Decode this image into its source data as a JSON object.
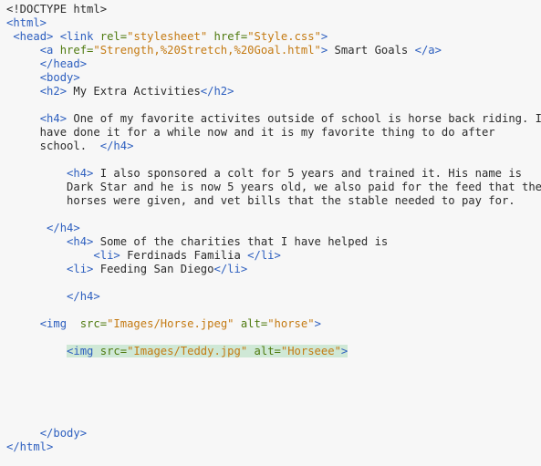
{
  "editor": {
    "lines": [
      [
        [
          "txt",
          "<!DOCTYPE html>"
        ]
      ],
      [
        [
          "tag",
          "<html>"
        ]
      ],
      [
        [
          "txt",
          " "
        ],
        [
          "tag",
          "<head>"
        ],
        [
          "txt",
          " "
        ],
        [
          "tag",
          "<link "
        ],
        [
          "attr",
          "rel="
        ],
        [
          "str",
          "\"stylesheet\""
        ],
        [
          "txt",
          " "
        ],
        [
          "attr",
          "href="
        ],
        [
          "str",
          "\"Style.css\""
        ],
        [
          "tag",
          ">"
        ]
      ],
      [
        [
          "txt",
          "     "
        ],
        [
          "tag",
          "<a "
        ],
        [
          "attr",
          "href="
        ],
        [
          "str",
          "\"Strength,%20Stretch,%20Goal.html\""
        ],
        [
          "tag",
          ">"
        ],
        [
          "txt",
          " Smart Goals "
        ],
        [
          "tag",
          "</a>"
        ]
      ],
      [
        [
          "txt",
          "     "
        ],
        [
          "tag",
          "</head>"
        ]
      ],
      [
        [
          "txt",
          "     "
        ],
        [
          "tag",
          "<body>"
        ]
      ],
      [
        [
          "txt",
          "     "
        ],
        [
          "tag",
          "<h2>"
        ],
        [
          "txt",
          " My Extra Activities"
        ],
        [
          "tag",
          "</h2>"
        ]
      ],
      [],
      [
        [
          "txt",
          "     "
        ],
        [
          "tag",
          "<h4>"
        ],
        [
          "txt",
          " One of my favorite activites outside of school is horse back riding. I"
        ]
      ],
      [
        [
          "txt",
          "     have done it for a while now and it is my favorite thing to do after"
        ]
      ],
      [
        [
          "txt",
          "     school.  "
        ],
        [
          "tag",
          "</h4>"
        ]
      ],
      [],
      [
        [
          "txt",
          "         "
        ],
        [
          "tag",
          "<h4>"
        ],
        [
          "txt",
          " I also sponsored a colt for 5 years and trained it. His name is"
        ]
      ],
      [
        [
          "txt",
          "         Dark Star and he is now 5 years old, we also paid for the feed that the"
        ]
      ],
      [
        [
          "txt",
          "         horses were given, and vet bills that the stable needed to pay for."
        ]
      ],
      [],
      [
        [
          "txt",
          "      "
        ],
        [
          "tag",
          "</h4>"
        ]
      ],
      [
        [
          "txt",
          "         "
        ],
        [
          "tag",
          "<h4>"
        ],
        [
          "txt",
          " Some of the charities that I have helped is"
        ]
      ],
      [
        [
          "txt",
          "             "
        ],
        [
          "tag",
          "<li>"
        ],
        [
          "txt",
          " Ferdinads Familia "
        ],
        [
          "tag",
          "</li>"
        ]
      ],
      [
        [
          "txt",
          "         "
        ],
        [
          "tag",
          "<li>"
        ],
        [
          "txt",
          " Feeding San Diego"
        ],
        [
          "tag",
          "</li>"
        ]
      ],
      [],
      [
        [
          "txt",
          "         "
        ],
        [
          "tag",
          "</h4>"
        ]
      ],
      [],
      [
        [
          "txt",
          "     "
        ],
        [
          "tag",
          "<img  "
        ],
        [
          "attr",
          "src="
        ],
        [
          "str",
          "\"Images/Horse.jpeg\""
        ],
        [
          "txt",
          " "
        ],
        [
          "attr",
          "alt="
        ],
        [
          "str",
          "\"horse\""
        ],
        [
          "tag",
          ">"
        ]
      ],
      [],
      [
        [
          "txt",
          "         "
        ],
        [
          "hl:tag",
          "<img "
        ],
        [
          "hl:attr",
          "src="
        ],
        [
          "hl:str",
          "\"Images/Teddy.jpg\""
        ],
        [
          "hl:txt",
          " "
        ],
        [
          "hl:attr",
          "alt="
        ],
        [
          "hl:str",
          "\"Horseee\""
        ],
        [
          "hl:tag",
          ">"
        ]
      ],
      [],
      [],
      [],
      [],
      [],
      [
        [
          "txt",
          "     "
        ],
        [
          "tag",
          "</body>"
        ]
      ],
      [
        [
          "tag",
          "</html>"
        ]
      ]
    ]
  }
}
